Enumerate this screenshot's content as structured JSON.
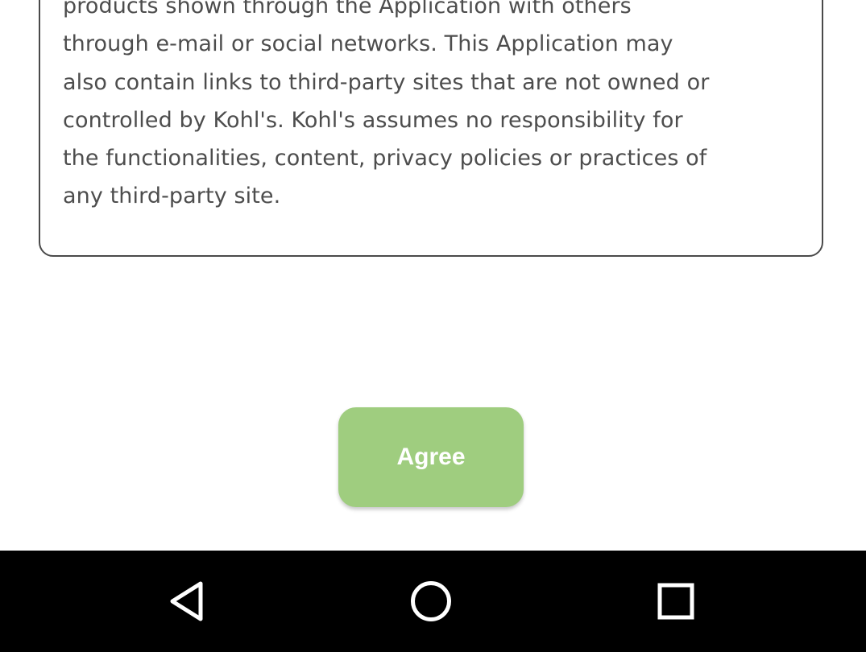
{
  "terms": {
    "lines": [
      "products shown through the Application with others",
      "through e-mail or social networks. This Application may",
      "also contain links to third-party sites that are not owned or",
      "controlled by Kohl's. Kohl's assumes no responsibility for",
      "the functionalities, content, privacy policies or practices of",
      "any third-party site."
    ]
  },
  "actions": {
    "agree_label": "Agree"
  },
  "navigation": {
    "back_icon": "back-triangle-icon",
    "home_icon": "home-circle-icon",
    "recents_icon": "recents-square-icon"
  },
  "colors": {
    "agree_button": "#9fcd7f",
    "text": "#4d4d4d",
    "border": "#4a4a4a",
    "nav_bar": "#000000"
  }
}
